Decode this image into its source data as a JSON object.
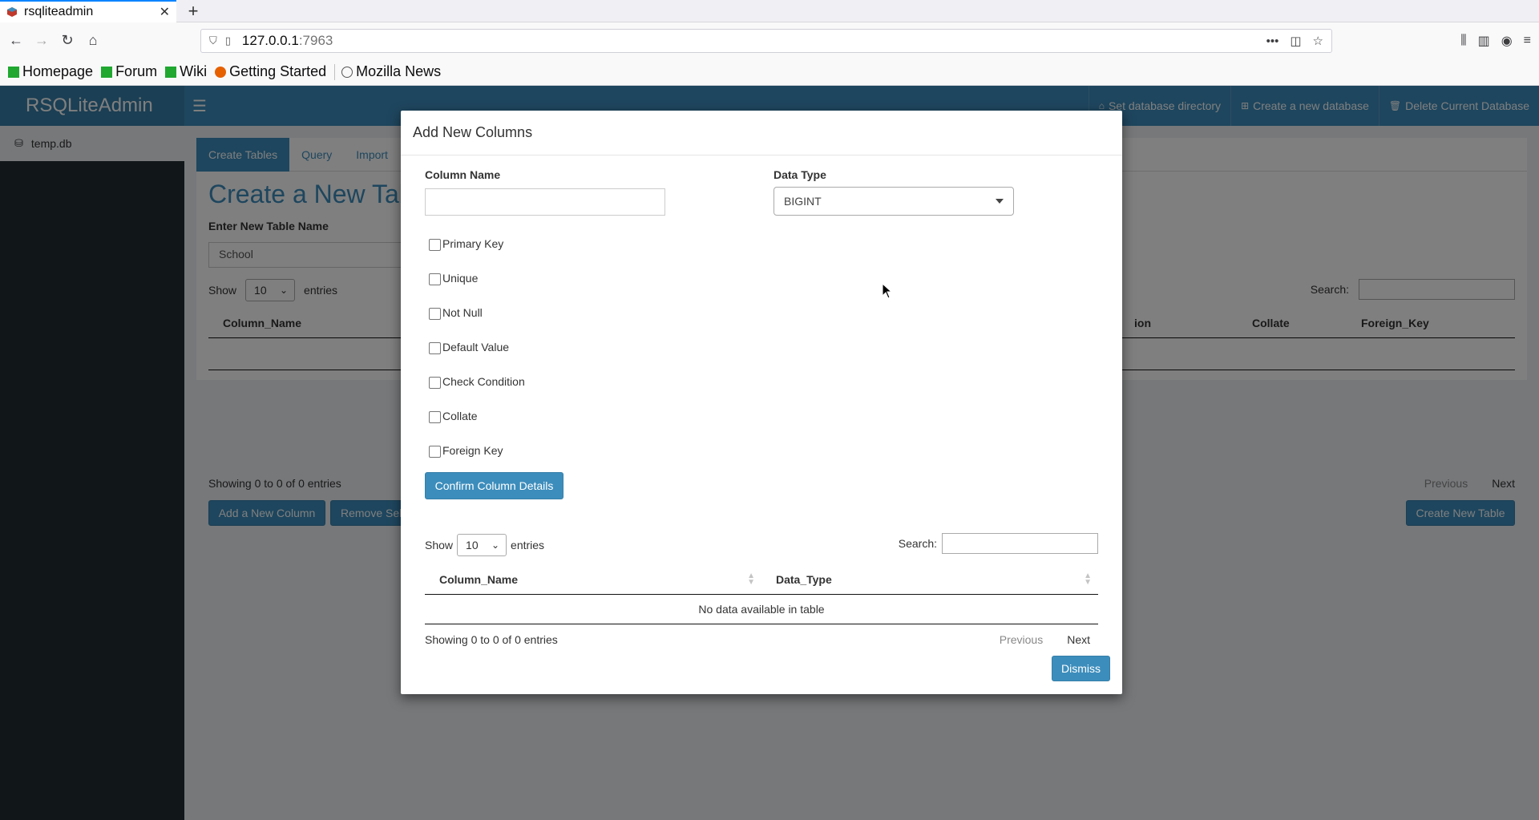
{
  "browser": {
    "tab_title": "rsqliteadmin",
    "url_host": "127.0.0.1",
    "url_port": ":7963",
    "bookmarks": [
      "Homepage",
      "Forum",
      "Wiki",
      "Getting Started",
      "Mozilla News"
    ]
  },
  "app": {
    "logo": "RSQLiteAdmin",
    "top_links": {
      "set_dir": "Set database directory",
      "create_db": "Create a new database",
      "delete_db": "Delete Current Database"
    },
    "sidebar": {
      "items": [
        {
          "label": "temp.db"
        }
      ]
    },
    "tabs": [
      "Create Tables",
      "Query",
      "Import"
    ],
    "page_title": "Create a New Tab",
    "table_name_label": "Enter New Table Name",
    "table_name_value": "School",
    "show_label": "Show",
    "show_value": "10",
    "entries_label": "entries",
    "search_label": "Search:",
    "columns": [
      "Column_Name",
      "ion",
      "Collate",
      "Foreign_Key"
    ],
    "info": "Showing 0 to 0 of 0 entries",
    "prev": "Previous",
    "next": "Next",
    "add_column": "Add a New Column",
    "remove_sel": "Remove Sel",
    "create_table": "Create New Table"
  },
  "modal": {
    "title": "Add New Columns",
    "column_name_label": "Column Name",
    "column_name_value": "",
    "data_type_label": "Data Type",
    "data_type_value": "BIGINT",
    "checkboxes": [
      "Primary Key",
      "Unique",
      "Not Null",
      "Default Value",
      "Check Condition",
      "Collate",
      "Foreign Key"
    ],
    "confirm": "Confirm Column Details",
    "show_label": "Show",
    "show_value": "10",
    "entries_label": "entries",
    "search_label": "Search:",
    "table_headers": [
      "Column_Name",
      "Data_Type"
    ],
    "empty_text": "No data available in table",
    "info": "Showing 0 to 0 of 0 entries",
    "prev": "Previous",
    "next": "Next",
    "dismiss": "Dismiss"
  }
}
